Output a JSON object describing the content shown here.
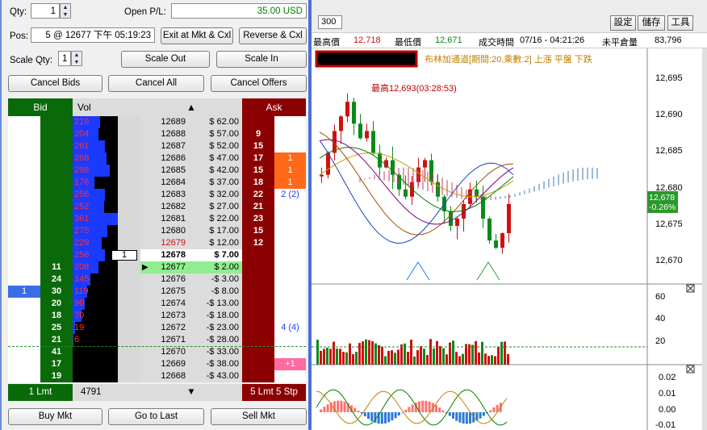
{
  "panel": {
    "qty_label": "Qty:",
    "qty_value": "1",
    "open_pl_label": "Open P/L:",
    "open_pl_value": "35.00 USD",
    "pos_label": "Pos:",
    "pos_value": "5 @ 12677 下午 05:19:23",
    "scale_qty_label": "Scale Qty:",
    "scale_qty_value": "1",
    "exit_button": "Exit at Mkt & Cxl",
    "reverse_button": "Reverse & Cxl",
    "scale_out_button": "Scale Out",
    "scale_in_button": "Scale In",
    "cancel_bids_button": "Cancel Bids",
    "cancel_all_button": "Cancel All",
    "cancel_offers_button": "Cancel Offers",
    "buy_mkt_button": "Buy Mkt",
    "go_to_last_button": "Go to Last",
    "sell_mkt_button": "Sell Mkt"
  },
  "ladder": {
    "headers": {
      "bid": "Bid",
      "vol": "Vol",
      "ask": "Ask"
    },
    "rows": [
      {
        "my_bid": "",
        "bid": "",
        "vol": "219",
        "price": "12689",
        "pl": "$ 62.00",
        "ask": "",
        "my_ask": ""
      },
      {
        "my_bid": "",
        "bid": "",
        "vol": "204",
        "price": "12688",
        "pl": "$ 57.00",
        "ask": "9",
        "my_ask": ""
      },
      {
        "my_bid": "",
        "bid": "",
        "vol": "261",
        "price": "12687",
        "pl": "$ 52.00",
        "ask": "15",
        "my_ask": ""
      },
      {
        "my_bid": "",
        "bid": "",
        "vol": "268",
        "price": "12686",
        "pl": "$ 47.00",
        "ask": "17",
        "my_ask": "1"
      },
      {
        "my_bid": "",
        "bid": "",
        "vol": "298",
        "price": "12685",
        "pl": "$ 42.00",
        "ask": "15",
        "my_ask": "1"
      },
      {
        "my_bid": "",
        "bid": "",
        "vol": "176",
        "price": "12684",
        "pl": "$ 37.00",
        "ask": "18",
        "my_ask": "1"
      },
      {
        "my_bid": "",
        "bid": "",
        "vol": "256",
        "price": "12683",
        "pl": "$ 32.00",
        "ask": "22",
        "my_ask": "2 (2)"
      },
      {
        "my_bid": "",
        "bid": "",
        "vol": "252",
        "price": "12682",
        "pl": "$ 27.00",
        "ask": "21",
        "my_ask": ""
      },
      {
        "my_bid": "",
        "bid": "",
        "vol": "361",
        "price": "12681",
        "pl": "$ 22.00",
        "ask": "23",
        "my_ask": ""
      },
      {
        "my_bid": "",
        "bid": "",
        "vol": "275",
        "price": "12680",
        "pl": "$ 17.00",
        "ask": "15",
        "my_ask": ""
      },
      {
        "my_bid": "",
        "bid": "",
        "vol": "229",
        "price": "12679",
        "pl": "$ 12.00",
        "ask": "12",
        "my_ask": ""
      },
      {
        "my_bid": "",
        "bid": "",
        "vol": "256",
        "price": "12678",
        "pl": "$ 7.00",
        "ask": "",
        "my_ask": "",
        "last_qty": "1"
      },
      {
        "my_bid": "",
        "bid": "11",
        "vol": "208",
        "price": "12677",
        "pl": "$ 2.00",
        "ask": "",
        "my_ask": ""
      },
      {
        "my_bid": "",
        "bid": "24",
        "vol": "145",
        "price": "12676",
        "pl": "-$ 3.00",
        "ask": "",
        "my_ask": ""
      },
      {
        "my_bid": "1",
        "bid": "30",
        "vol": "119",
        "price": "12675",
        "pl": "-$ 8.00",
        "ask": "",
        "my_ask": ""
      },
      {
        "my_bid": "",
        "bid": "20",
        "vol": "96",
        "price": "12674",
        "pl": "-$ 13.00",
        "ask": "",
        "my_ask": ""
      },
      {
        "my_bid": "",
        "bid": "18",
        "vol": "70",
        "price": "12673",
        "pl": "-$ 18.00",
        "ask": "",
        "my_ask": ""
      },
      {
        "my_bid": "",
        "bid": "25",
        "vol": "19",
        "price": "12672",
        "pl": "-$ 23.00",
        "ask": "",
        "my_ask": "4 (4)"
      },
      {
        "my_bid": "",
        "bid": "21",
        "vol": "6",
        "price": "12671",
        "pl": "-$ 28.00",
        "ask": "",
        "my_ask": ""
      },
      {
        "my_bid": "",
        "bid": "41",
        "vol": "",
        "price": "12670",
        "pl": "-$ 33.00",
        "ask": "",
        "my_ask": ""
      },
      {
        "my_bid": "",
        "bid": "17",
        "vol": "",
        "price": "12669",
        "pl": "-$ 38.00",
        "ask": "",
        "my_ask": "+1"
      },
      {
        "my_bid": "",
        "bid": "19",
        "vol": "",
        "price": "12668",
        "pl": "-$ 43.00",
        "ask": "",
        "my_ask": ""
      }
    ],
    "footer": {
      "bid_orders": "1 Lmt",
      "total_vol": "4791",
      "ask_orders": "5 Lmt 5 Stp"
    }
  },
  "chart": {
    "interval_value": "300",
    "buttons": {
      "settings": "設定",
      "save": "儲存",
      "tools": "工具"
    },
    "quote": {
      "high_label": "最高價",
      "high_value": "12,718",
      "low_label": "最低價",
      "low_value": "12,671",
      "time_label": "成交時間",
      "time_value": "07/16 - 04:21:26",
      "oi_label": "未平倉量",
      "oi_value": "83,796"
    },
    "legend": "布林加通道[期間:20,乘數:2] 上漲  平盤  下跌",
    "high_annotation": "最高12,693(03:28:53)",
    "price_axis": [
      "12,695",
      "12,690",
      "12,685",
      "12,680",
      "12,675",
      "12,670"
    ],
    "last_price": "12,678",
    "last_change": "-0.26%",
    "vol_axis": [
      "60",
      "40",
      "20"
    ],
    "osc_axis": [
      "0.02",
      "0.01",
      "0.00",
      "-0.01"
    ],
    "colors": {
      "up": "#d01010",
      "down": "#0a8a1a",
      "ask_bg": "#8b0000",
      "bid_bg": "#0a6a0a",
      "vol_bar": "#1a3aff"
    }
  }
}
